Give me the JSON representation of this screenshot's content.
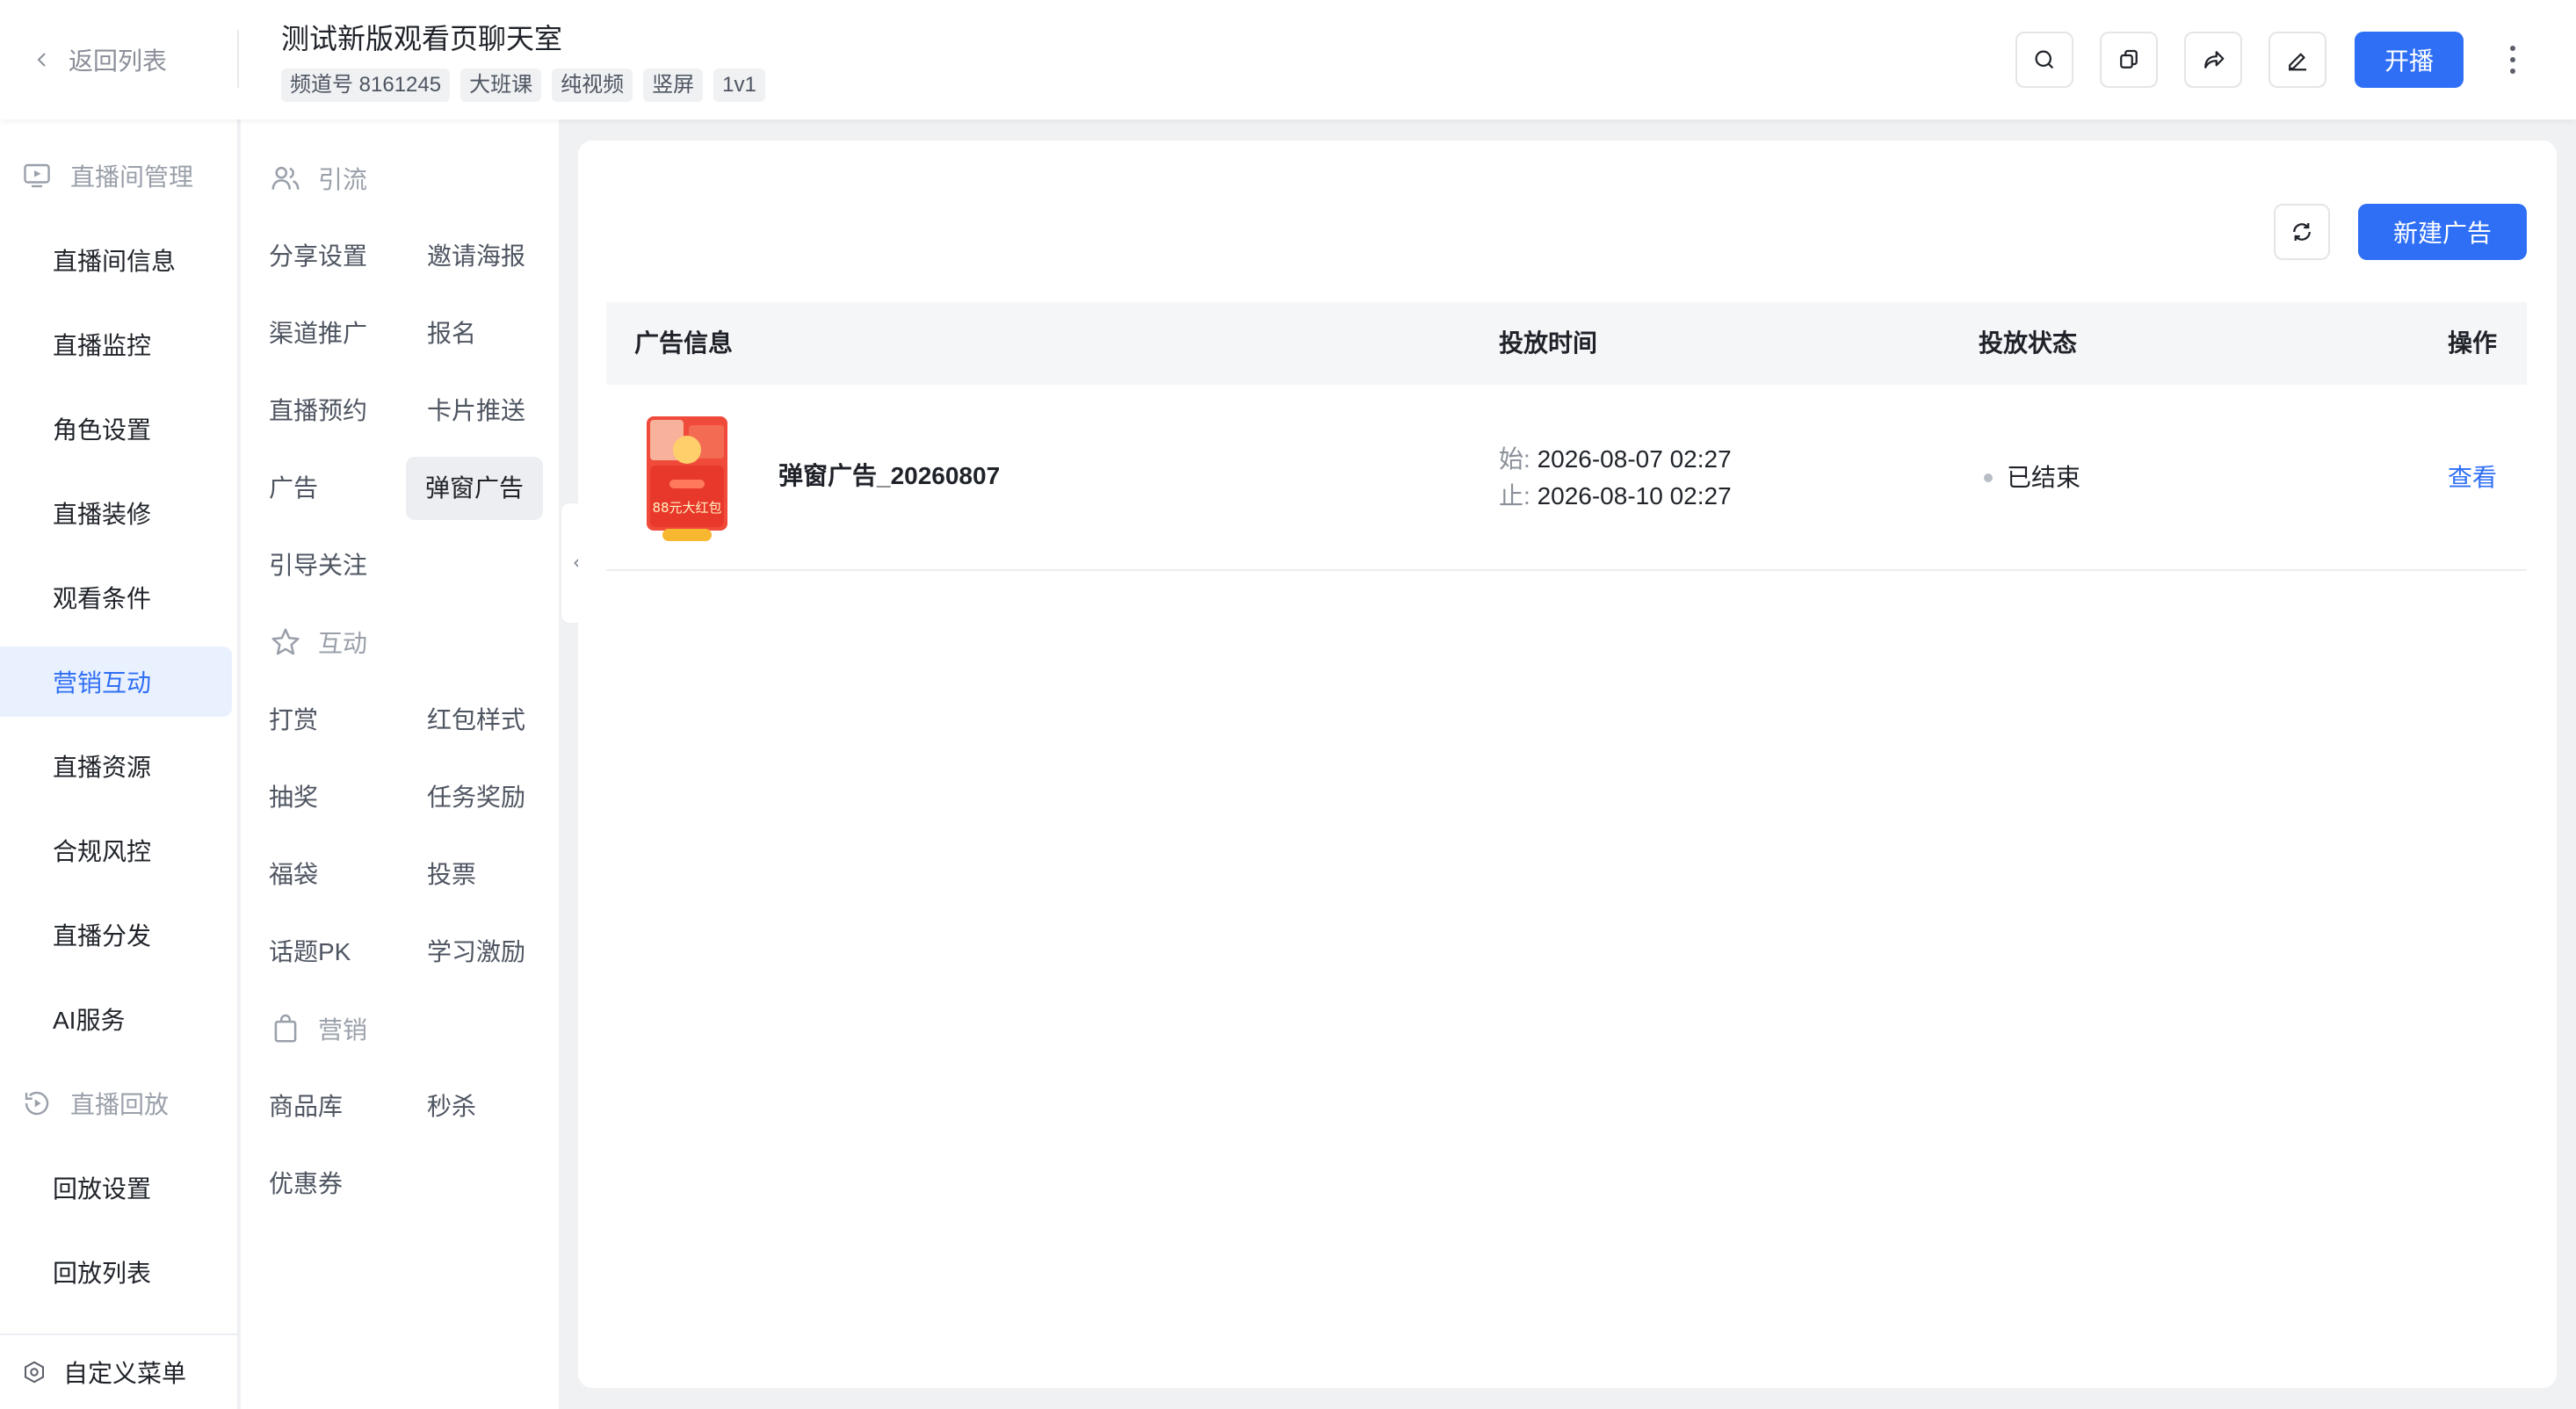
{
  "header": {
    "back_label": "返回列表",
    "title": "测试新版观看页聊天室",
    "tags": [
      "频道号 8161245",
      "大班课",
      "纯视频",
      "竖屏",
      "1v1"
    ],
    "icons": [
      "search-icon",
      "copy-icon",
      "share-icon",
      "edit-icon"
    ],
    "start_label": "开播",
    "accent": "#2f6ff5"
  },
  "sidebar": {
    "group_live": "直播间管理",
    "items_live": [
      "直播间信息",
      "直播监控",
      "角色设置",
      "直播装修",
      "观看条件",
      "营销互动",
      "直播资源",
      "合规风控",
      "直播分发",
      "AI服务"
    ],
    "active_item": "营销互动",
    "group_replay": "直播回放",
    "items_replay": [
      "回放设置",
      "回放列表"
    ],
    "footer_label": "自定义菜单"
  },
  "midmenu": {
    "section_traffic": "引流",
    "traffic_items": [
      "分享设置",
      "邀请海报",
      "渠道推广",
      "报名",
      "直播预约",
      "卡片推送",
      "广告",
      "弹窗广告",
      "引导关注"
    ],
    "active_item": "弹窗广告",
    "section_interact": "互动",
    "interact_items": [
      "打赏",
      "红包样式",
      "抽奖",
      "任务奖励",
      "福袋",
      "投票",
      "话题PK",
      "学习激励"
    ],
    "section_marketing": "营销",
    "marketing_items": [
      "商品库",
      "秒杀",
      "优惠券"
    ]
  },
  "content": {
    "new_ad_label": "新建广告",
    "columns": [
      "广告信息",
      "投放时间",
      "投放状态",
      "操作"
    ],
    "rows": [
      {
        "name": "弹窗广告_20260807",
        "start_label": "始:",
        "start": "2026-08-07 02:27",
        "end_label": "止:",
        "end": "2026-08-10 02:27",
        "status": "已结束",
        "action": "查看",
        "thumb_text": "88元大红包"
      }
    ]
  }
}
